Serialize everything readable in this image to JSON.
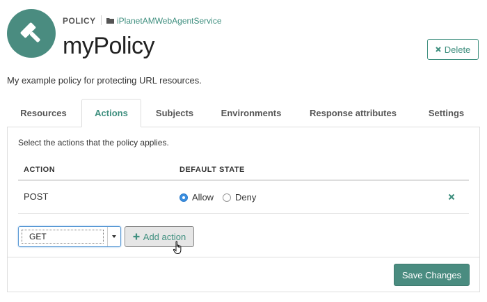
{
  "header": {
    "kind_label": "POLICY",
    "application_name": "iPlanetAMWebAgentService",
    "title": "myPolicy",
    "delete_label": "Delete",
    "icon": "gavel-icon"
  },
  "description": "My example policy for protecting URL resources.",
  "tabs": [
    {
      "label": "Resources",
      "active": false
    },
    {
      "label": "Actions",
      "active": true
    },
    {
      "label": "Subjects",
      "active": false
    },
    {
      "label": "Environments",
      "active": false
    },
    {
      "label": "Response attributes",
      "active": false
    },
    {
      "label": "Settings",
      "active": false
    }
  ],
  "actions_panel": {
    "instructions": "Select the actions that the policy applies.",
    "columns": [
      "ACTION",
      "DEFAULT STATE"
    ],
    "rows": [
      {
        "action": "POST",
        "options": [
          "Allow",
          "Deny"
        ],
        "selected": "Allow"
      }
    ],
    "new_action_select_value": "GET",
    "add_action_label": "Add action",
    "save_label": "Save Changes"
  },
  "colors": {
    "accent": "#3f8f7f",
    "primary_button": "#4a8c80",
    "radio_selected": "#3b8fe0"
  }
}
